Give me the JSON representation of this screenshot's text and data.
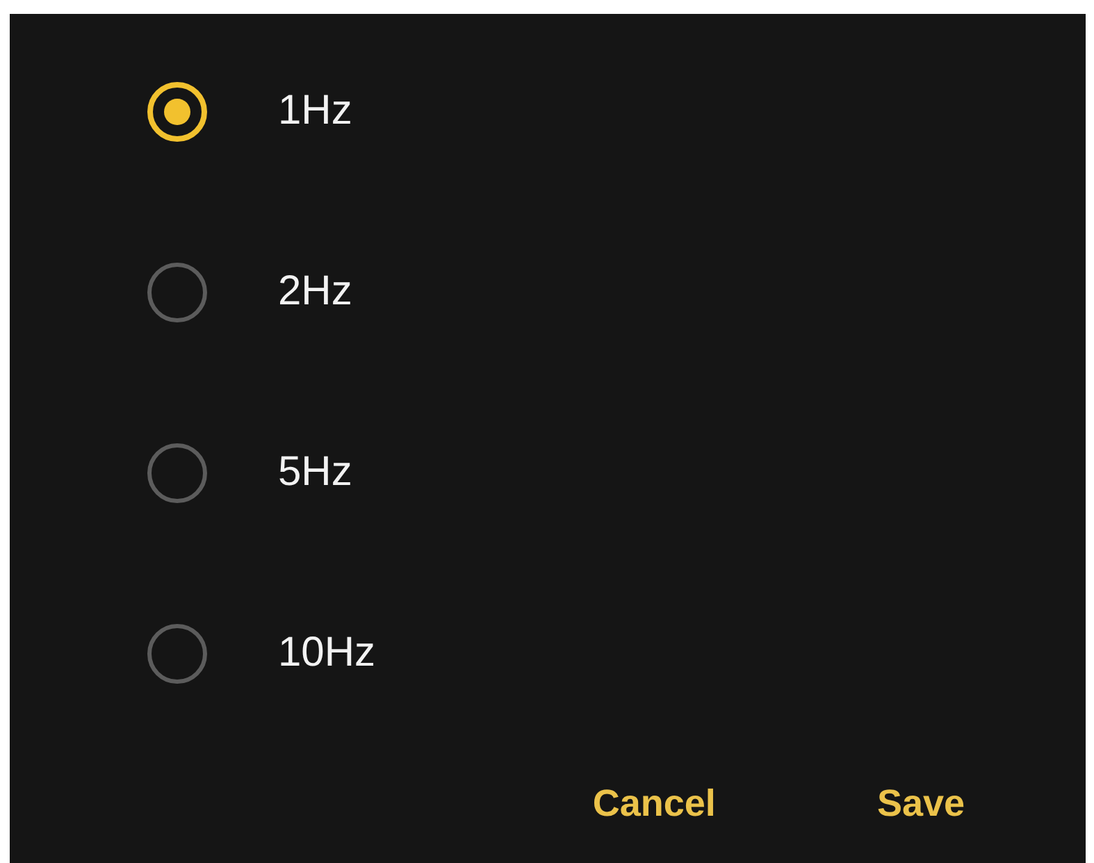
{
  "options": [
    {
      "label": "1Hz",
      "selected": true
    },
    {
      "label": "2Hz",
      "selected": false
    },
    {
      "label": "5Hz",
      "selected": false
    },
    {
      "label": "10Hz",
      "selected": false
    }
  ],
  "buttons": [
    "Cancel",
    "Save"
  ]
}
